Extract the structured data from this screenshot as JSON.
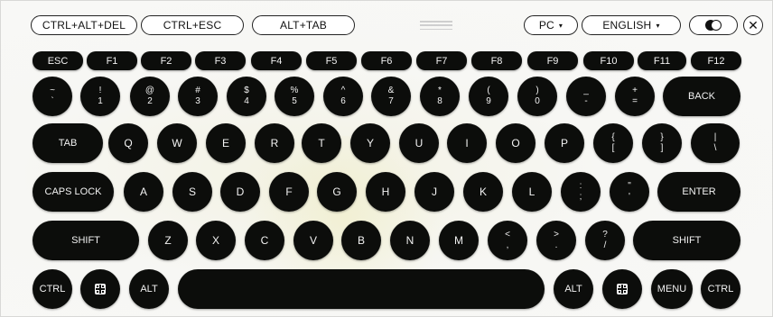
{
  "toolbar": {
    "ctrl_alt_del": "CTRL+ALT+DEL",
    "ctrl_esc": "CTRL+ESC",
    "alt_tab": "ALT+TAB",
    "layout_select": "PC",
    "language_select": "ENGLISH",
    "caret": "▾",
    "close": "✕"
  },
  "keys": {
    "esc": "ESC",
    "f": [
      "F1",
      "F2",
      "F3",
      "F4",
      "F5",
      "F6",
      "F7",
      "F8",
      "F9",
      "F10",
      "F11",
      "F12"
    ],
    "number_row": [
      {
        "top": "~",
        "bottom": "`"
      },
      {
        "top": "!",
        "bottom": "1"
      },
      {
        "top": "@",
        "bottom": "2"
      },
      {
        "top": "#",
        "bottom": "3"
      },
      {
        "top": "$",
        "bottom": "4"
      },
      {
        "top": "%",
        "bottom": "5"
      },
      {
        "top": "^",
        "bottom": "6"
      },
      {
        "top": "&",
        "bottom": "7"
      },
      {
        "top": "*",
        "bottom": "8"
      },
      {
        "top": "(",
        "bottom": "9"
      },
      {
        "top": ")",
        "bottom": "0"
      },
      {
        "top": "_",
        "bottom": "-"
      },
      {
        "top": "+",
        "bottom": "="
      }
    ],
    "back": "BACK",
    "tab": "TAB",
    "q_row": [
      "Q",
      "W",
      "E",
      "R",
      "T",
      "Y",
      "U",
      "I",
      "O",
      "P"
    ],
    "q_row_sym": [
      {
        "top": "{",
        "bottom": "["
      },
      {
        "top": "}",
        "bottom": "]"
      },
      {
        "top": "|",
        "bottom": "\\"
      }
    ],
    "caps": "CAPS LOCK",
    "a_row": [
      "A",
      "S",
      "D",
      "F",
      "G",
      "H",
      "J",
      "K",
      "L"
    ],
    "a_row_sym": [
      {
        "top": ":",
        "bottom": ";"
      },
      {
        "top": "\"",
        "bottom": "'"
      }
    ],
    "enter": "ENTER",
    "shift": "SHIFT",
    "z_row": [
      "Z",
      "X",
      "C",
      "V",
      "B",
      "N",
      "M"
    ],
    "z_row_sym": [
      {
        "top": "<",
        "bottom": ","
      },
      {
        "top": ">",
        "bottom": "."
      },
      {
        "top": "?",
        "bottom": "/"
      }
    ],
    "ctrl": "CTRL",
    "alt": "ALT",
    "menu": "MENU"
  }
}
